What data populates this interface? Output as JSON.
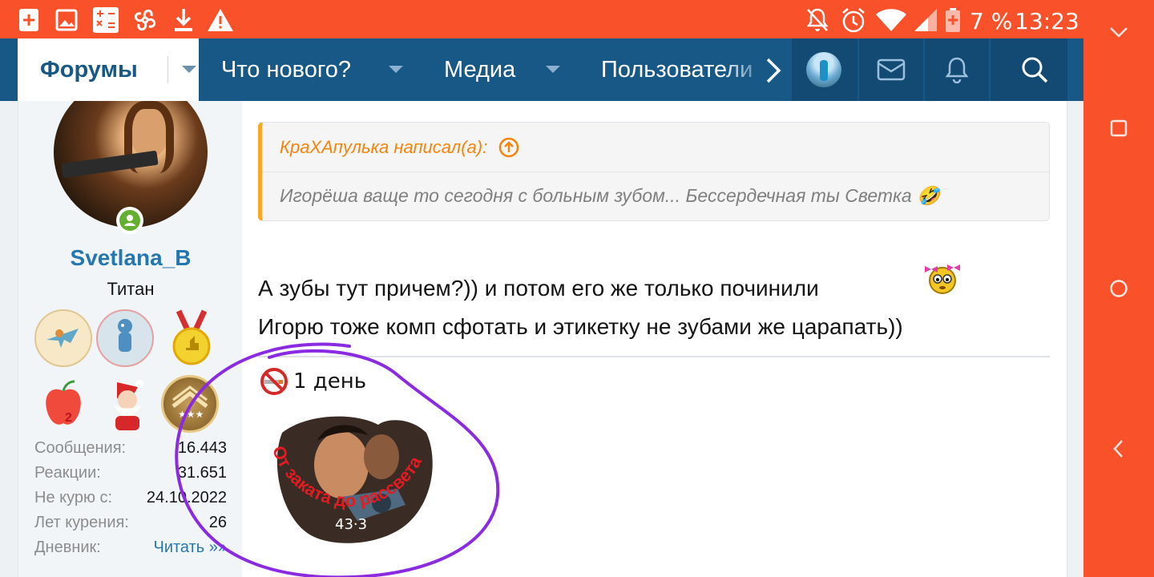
{
  "status_bar": {
    "time": "13:23",
    "battery_percent": "7 %",
    "icons": [
      "add-box-icon",
      "image-icon",
      "calculator-icon",
      "pinwheel-icon",
      "download-icon",
      "warning-icon",
      "notifications-off-icon",
      "alarm-icon",
      "wifi-icon",
      "signal-icon",
      "battery-icon"
    ]
  },
  "nav_rail": {
    "icons": [
      "chevron-down-icon",
      "recents-icon",
      "home-icon",
      "back-icon"
    ]
  },
  "header": {
    "tabs": [
      {
        "label": "Форумы"
      },
      {
        "label": "Что нового?"
      },
      {
        "label": "Медиа"
      },
      {
        "label": "Пользователи"
      }
    ],
    "icons": [
      "chevron-right-icon",
      "user-avatar",
      "mail-icon",
      "bell-icon",
      "search-icon"
    ]
  },
  "user": {
    "name": "Svetlana_B",
    "title": "Титан",
    "awards": [
      "plane-award",
      "figure-award",
      "medal-award",
      "apple-2-award",
      "santa-award",
      "rank-stars-award"
    ],
    "stats": [
      {
        "label": "Сообщения:",
        "value": "16.443"
      },
      {
        "label": "Реакции:",
        "value": "31.651"
      },
      {
        "label": "Не курю с:",
        "value": "24.10.2022"
      },
      {
        "label": "Лет курения:",
        "value": "26"
      },
      {
        "label": "Дневник:",
        "value": "Читать »»"
      }
    ]
  },
  "post": {
    "quote": {
      "author": "КраХАпулька написал(а):",
      "text": "Игорёша ваще то сегодня с больным зубом... Бессердечная ты Светка 🤣"
    },
    "message_line1": "А зубы тут причем?)) и потом его же только починили",
    "message_line2": "Игорю тоже комп сфотать и этикетку не зубами же царапать))",
    "signature": {
      "text": "1 день",
      "badge_text": "От заката до рассвета",
      "badge_number": "43·3"
    }
  },
  "colors": {
    "status_bar": "#f9512a",
    "header": "#185886",
    "accent_link": "#2577b1",
    "quote_author": "#f5840b",
    "quote_border": "#f9a825",
    "annotation_stroke": "#8a2be2"
  }
}
